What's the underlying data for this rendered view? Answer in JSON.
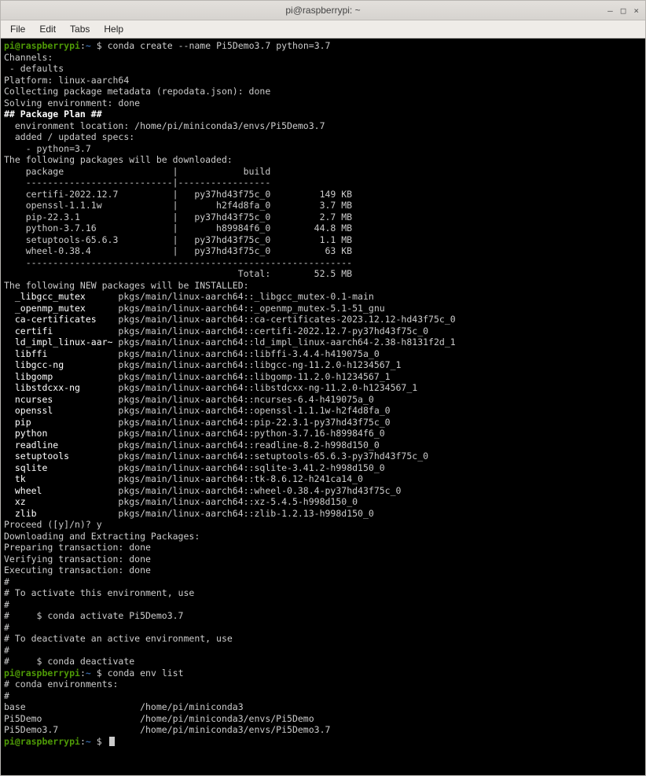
{
  "window": {
    "title": "pi@raspberrypi: ~",
    "min": "–",
    "max": "□",
    "close": "×"
  },
  "menu": [
    "File",
    "Edit",
    "Tabs",
    "Help"
  ],
  "prompt": {
    "user": "pi",
    "host": "raspberrypi",
    "sep1": "@",
    "sep2": ":",
    "path": "~",
    "dollar": "$"
  },
  "cmd1": "conda create --name Pi5Demo3.7 python=3.7",
  "cmd2": "conda env list",
  "header": [
    "Channels:",
    " - defaults",
    "Platform: linux-aarch64",
    "Collecting package metadata (repodata.json): done",
    "Solving environment: done"
  ],
  "plan_title": "## Package Plan ##",
  "env_loc_label": "  environment location: ",
  "env_loc": "/home/pi/miniconda3/envs/Pi5Demo3.7",
  "specs_label": "  added / updated specs:",
  "specs": [
    "    - python=3.7"
  ],
  "dl_title": "The following packages will be downloaded:",
  "dl_head": "    package                    |            build",
  "dl_sep": "    ---------------------------|-----------------",
  "downloads": [
    "    certifi-2022.12.7          |   py37hd43f75c_0         149 KB",
    "    openssl-1.1.1w             |       h2f4d8fa_0         3.7 MB",
    "    pip-22.3.1                 |   py37hd43f75c_0         2.7 MB",
    "    python-3.7.16              |       h89984f6_0        44.8 MB",
    "    setuptools-65.6.3          |   py37hd43f75c_0         1.1 MB",
    "    wheel-0.38.4               |   py37hd43f75c_0          63 KB"
  ],
  "dl_sep2": "    ------------------------------------------------------------",
  "dl_total": "                                           Total:        52.5 MB",
  "inst_title": "The following NEW packages will be INSTALLED:",
  "installs": [
    [
      "  _libgcc_mutex     ",
      "pkgs/main/linux-aarch64::_libgcc_mutex-0.1-main"
    ],
    [
      "  _openmp_mutex     ",
      "pkgs/main/linux-aarch64::_openmp_mutex-5.1-51_gnu"
    ],
    [
      "  ca-certificates   ",
      "pkgs/main/linux-aarch64::ca-certificates-2023.12.12-hd43f75c_0"
    ],
    [
      "  certifi           ",
      "pkgs/main/linux-aarch64::certifi-2022.12.7-py37hd43f75c_0"
    ],
    [
      "  ld_impl_linux-aar~",
      "pkgs/main/linux-aarch64::ld_impl_linux-aarch64-2.38-h8131f2d_1"
    ],
    [
      "  libffi            ",
      "pkgs/main/linux-aarch64::libffi-3.4.4-h419075a_0"
    ],
    [
      "  libgcc-ng         ",
      "pkgs/main/linux-aarch64::libgcc-ng-11.2.0-h1234567_1"
    ],
    [
      "  libgomp           ",
      "pkgs/main/linux-aarch64::libgomp-11.2.0-h1234567_1"
    ],
    [
      "  libstdcxx-ng      ",
      "pkgs/main/linux-aarch64::libstdcxx-ng-11.2.0-h1234567_1"
    ],
    [
      "  ncurses           ",
      "pkgs/main/linux-aarch64::ncurses-6.4-h419075a_0"
    ],
    [
      "  openssl           ",
      "pkgs/main/linux-aarch64::openssl-1.1.1w-h2f4d8fa_0"
    ],
    [
      "  pip               ",
      "pkgs/main/linux-aarch64::pip-22.3.1-py37hd43f75c_0"
    ],
    [
      "  python            ",
      "pkgs/main/linux-aarch64::python-3.7.16-h89984f6_0"
    ],
    [
      "  readline          ",
      "pkgs/main/linux-aarch64::readline-8.2-h998d150_0"
    ],
    [
      "  setuptools        ",
      "pkgs/main/linux-aarch64::setuptools-65.6.3-py37hd43f75c_0"
    ],
    [
      "  sqlite            ",
      "pkgs/main/linux-aarch64::sqlite-3.41.2-h998d150_0"
    ],
    [
      "  tk                ",
      "pkgs/main/linux-aarch64::tk-8.6.12-h241ca14_0"
    ],
    [
      "  wheel             ",
      "pkgs/main/linux-aarch64::wheel-0.38.4-py37hd43f75c_0"
    ],
    [
      "  xz                ",
      "pkgs/main/linux-aarch64::xz-5.4.5-h998d150_0"
    ],
    [
      "  zlib              ",
      "pkgs/main/linux-aarch64::zlib-1.2.13-h998d150_0"
    ]
  ],
  "proceed": "Proceed ([y]/n)? y",
  "download_extract": "Downloading and Extracting Packages:",
  "txn": [
    "Preparing transaction: done",
    "Verifying transaction: done",
    "Executing transaction: done"
  ],
  "post": [
    "#",
    "# To activate this environment, use",
    "#",
    "#     $ conda activate Pi5Demo3.7",
    "#",
    "# To deactivate an active environment, use",
    "#",
    "#     $ conda deactivate",
    ""
  ],
  "envlist_header": "# conda environments:",
  "envlist_hash": "#",
  "envs": [
    "base                     /home/pi/miniconda3",
    "Pi5Demo                  /home/pi/miniconda3/envs/Pi5Demo",
    "Pi5Demo3.7               /home/pi/miniconda3/envs/Pi5Demo3.7"
  ]
}
